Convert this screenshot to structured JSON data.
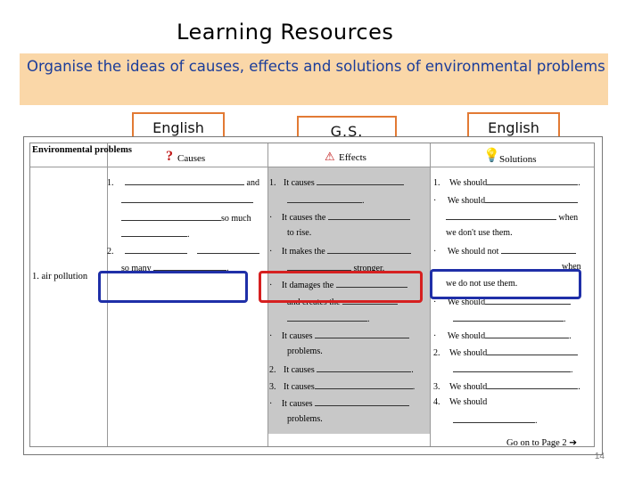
{
  "title": "Learning Resources",
  "instruction": "Organise the ideas of causes, effects and solutions of environmental problems",
  "column_labels": [
    "English",
    "G.S.",
    "English"
  ],
  "worksheet": {
    "heading_col1": "Environmental problems",
    "heading_causes": "Causes",
    "heading_effects": "Effects",
    "heading_solutions": "Solutions",
    "row_label": "1. air pollution",
    "causes": {
      "n1": "1.",
      "and": "and",
      "so_much": "so much",
      "dot1": ".",
      "n2": "2.",
      "so_many": "so many",
      "dot2": "."
    },
    "effects": {
      "n1": "1.",
      "c1": "It causes",
      "bullet": "·",
      "c2": "It causes the",
      "to_rise": "to rise.",
      "c3": "It makes the",
      "stronger": "stronger.",
      "c4": "It damages the",
      "create": "and creates the",
      "c5": "It causes",
      "problems": "problems.",
      "n2": "2.",
      "c6": "It causes",
      "n3": "3.",
      "c7": "It causes",
      "c8": "It causes",
      "problems2": "problems."
    },
    "solutions": {
      "n1": "1.",
      "s1": "We should",
      "bullet": "·",
      "s2": "We should",
      "when": "when",
      "dont_use": "we don't use them.",
      "s3": "We should not",
      "when2": "when",
      "do_not_use": "we do not use them.",
      "s4": "We should",
      "s5": "We should",
      "n2": "2.",
      "s6": "We should",
      "n3": "3.",
      "s7": "We should",
      "n4": "4.",
      "s8": "We should"
    },
    "footer": "Go on to Page 2"
  },
  "page_number": "14",
  "colors": {
    "highlight_blue": "#1f2fa8",
    "highlight_red": "#d62020",
    "label_border": "#e27a34",
    "instruction_bg": "#fad7a8"
  }
}
